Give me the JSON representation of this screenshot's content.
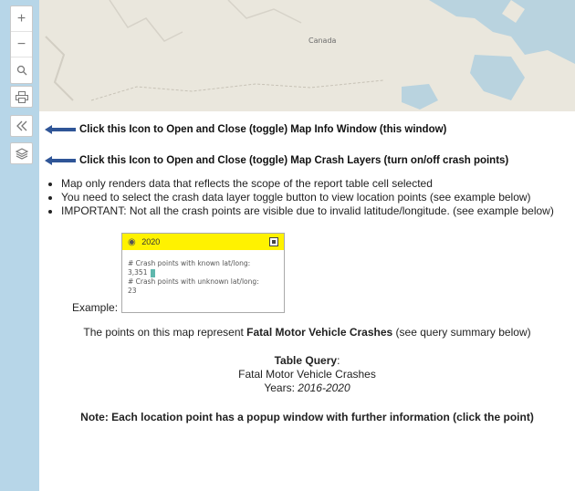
{
  "map": {
    "label": "Canada"
  },
  "toolbar": {
    "zoom_in": "+",
    "zoom_out": "−"
  },
  "hints": {
    "toggle_info": "Click this Icon to Open and Close (toggle) Map Info Window (this window)",
    "toggle_layers": "Click this Icon to Open and Close (toggle) Map Crash Layers (turn on/off crash points)"
  },
  "bullets": [
    "Map only renders data that reflects the scope of the report table cell selected",
    "You need to select the crash data layer toggle button to view location points (see example below)",
    "IMPORTANT: Not all the crash points are visible due to invalid latitude/longitude. (see example below)"
  ],
  "example": {
    "label": "Example:",
    "year": "2020",
    "known_label": "# Crash points with known lat/long:",
    "known_value": "3,351",
    "unknown_label": "# Crash points with unknown lat/long:",
    "unknown_value": "23",
    "highlight_color": "#fff200",
    "swatch_color": "#5fb7ad"
  },
  "summary": {
    "prefix": "The points on this map represent ",
    "bold": "Fatal Motor Vehicle Crashes",
    "suffix": " (see query summary below)"
  },
  "query": {
    "title": "Table Query",
    "colon": ":",
    "name": "Fatal Motor Vehicle Crashes",
    "years_label": "Years: ",
    "years_value": "2016-2020"
  },
  "note": "Note: Each location point has a popup window with further information (click the point)"
}
